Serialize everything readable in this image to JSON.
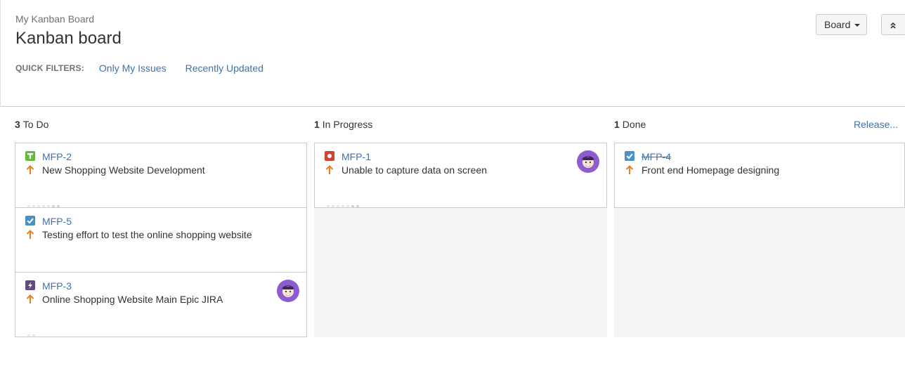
{
  "header": {
    "breadcrumb": "My Kanban Board",
    "title": "Kanban board",
    "quick_filters_label": "QUICK FILTERS:",
    "quick_filters": [
      "Only My Issues",
      "Recently Updated"
    ],
    "board_button": "Board",
    "collapse_icon": "double-chevron-up-icon"
  },
  "columns": [
    {
      "count": "3",
      "name": "To Do"
    },
    {
      "count": "1",
      "name": "In Progress"
    },
    {
      "count": "1",
      "name": "Done",
      "action": "Release..."
    }
  ],
  "cards": {
    "todo": [
      {
        "key": "MFP-2",
        "summary": "New Shopping Website Development",
        "type": "story-icon",
        "priority": "priority-major-icon"
      },
      {
        "key": "MFP-5",
        "summary": "Testing effort to test the online shopping website",
        "type": "task-icon",
        "priority": "priority-major-icon"
      },
      {
        "key": "MFP-3",
        "summary": "Online Shopping Website Main Epic JIRA",
        "type": "epic-icon",
        "priority": "priority-major-icon",
        "avatar": "user-avatar-icon"
      }
    ],
    "progress": [
      {
        "key": "MFP-1",
        "summary": "Unable to capture data on screen",
        "type": "bug-icon",
        "priority": "priority-major-icon",
        "avatar": "user-avatar-icon"
      }
    ],
    "done": [
      {
        "key": "MFP-4",
        "summary": "Front end Homepage designing",
        "type": "task-icon",
        "priority": "priority-major-icon"
      }
    ]
  },
  "colors": {
    "link": "#3b73af",
    "story": "#63ba3c",
    "task": "#4a6785",
    "bug": "#d04437",
    "epic": "#654982",
    "priority": "#e47f22",
    "avatar": "#8e5bd1"
  }
}
